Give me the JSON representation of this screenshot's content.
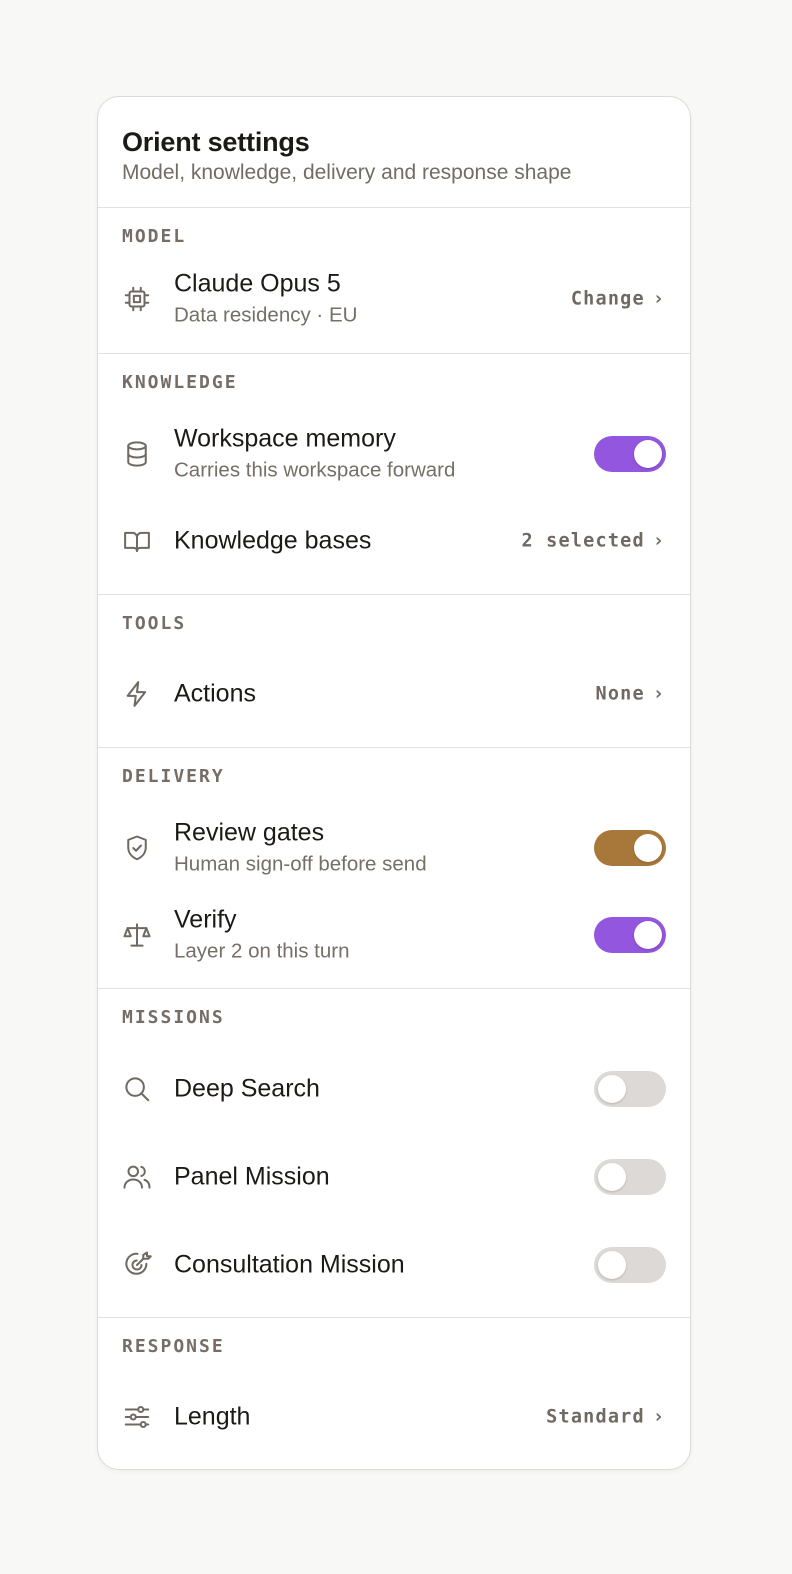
{
  "header": {
    "title": "Orient settings",
    "subtitle": "Model, knowledge, delivery and response shape"
  },
  "sections": {
    "model": {
      "label": "MODEL",
      "row": {
        "icon": "chip-icon",
        "title": "Claude Opus 5",
        "subtitle": "Data residency · EU",
        "value": "Change",
        "chevron": "›"
      }
    },
    "knowledge": {
      "label": "KNOWLEDGE",
      "memory": {
        "icon": "database-icon",
        "title": "Workspace memory",
        "subtitle": "Carries this workspace forward",
        "enabled": true,
        "color": "#9356df"
      },
      "bases": {
        "icon": "book-icon",
        "title": "Knowledge bases",
        "value": "2 selected",
        "chevron": "›"
      }
    },
    "tools": {
      "label": "TOOLS",
      "actions": {
        "icon": "lightning-icon",
        "title": "Actions",
        "value": "None",
        "chevron": "›"
      }
    },
    "delivery": {
      "label": "DELIVERY",
      "review": {
        "icon": "shield-check-icon",
        "title": "Review gates",
        "subtitle": "Human sign-off before send",
        "enabled": true,
        "color": "#a8783a"
      },
      "verify": {
        "icon": "scale-icon",
        "title": "Verify",
        "subtitle": "Layer 2 on this turn",
        "enabled": true,
        "color": "#9356df"
      }
    },
    "missions": {
      "label": "MISSIONS",
      "deep_search": {
        "icon": "search-icon",
        "title": "Deep Search",
        "enabled": false
      },
      "panel": {
        "icon": "users-icon",
        "title": "Panel Mission",
        "enabled": false
      },
      "consultation": {
        "icon": "target-icon",
        "title": "Consultation Mission",
        "enabled": false
      }
    },
    "response": {
      "label": "RESPONSE",
      "length": {
        "icon": "sliders-icon",
        "title": "Length",
        "value": "Standard",
        "chevron": "›"
      }
    }
  },
  "colors": {
    "accent_purple": "#9356df",
    "accent_bronze": "#a8783a",
    "toggle_off": "#dcd9d6"
  }
}
